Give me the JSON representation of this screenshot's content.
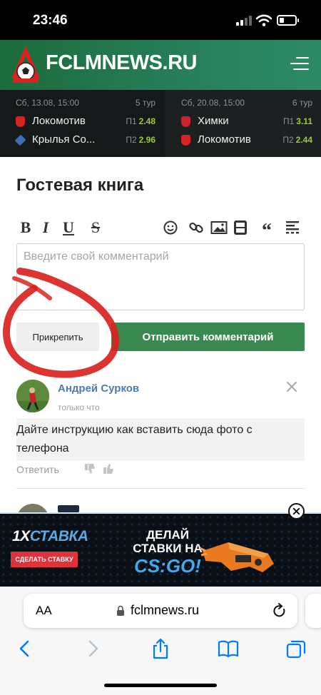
{
  "status_bar": {
    "time": "23:46",
    "battery_level": 0.3
  },
  "site": {
    "title": "FCLMNEWS.RU"
  },
  "matches": [
    {
      "date": "Сб, 13.08, 15:00",
      "round": "5 тур",
      "teams": [
        {
          "name": "Локомотив",
          "odds_label": "П1",
          "odds_value": "2.48"
        },
        {
          "name": "Крылья Со...",
          "odds_label": "П2",
          "odds_value": "2.96"
        }
      ]
    },
    {
      "date": "Сб, 20.08, 15:00",
      "round": "6 тур",
      "teams": [
        {
          "name": "Химки",
          "odds_label": "П1",
          "odds_value": "3.11"
        },
        {
          "name": "Локомотив",
          "odds_label": "П2",
          "odds_value": "2.44"
        }
      ]
    }
  ],
  "guestbook": {
    "title": "Гостевая книга",
    "editor": {
      "bold": "B",
      "italic": "I",
      "underline": "U",
      "strike": "S",
      "placeholder": "Введите свой комментарий"
    },
    "attach_label": "Прикрепить",
    "submit_label": "Отправить комментарий"
  },
  "comments": [
    {
      "author": "Андрей Сурков",
      "time": "только что",
      "text": "Дайте инструкцию как вставить сюда фото с телефона",
      "reply_label": "Ответить"
    }
  ],
  "ad": {
    "brand_prefix": "1X",
    "brand_suffix": "СТАВКА",
    "cta": "СДЕЛАТЬ СТАВКУ",
    "headline": "ДЕЛАЙ СТАВКИ НА",
    "game": "CS:GO!"
  },
  "browser": {
    "text_size_label": "AA",
    "url": "fclmnews.ru"
  },
  "colors": {
    "header_green": "#27805a",
    "submit_green": "#3a8a4f",
    "odds_green": "#9acd32",
    "author_blue": "#4a7bb5",
    "annotation_red": "#d8231f",
    "ad_red": "#e0323b",
    "ios_blue": "#007aff"
  }
}
